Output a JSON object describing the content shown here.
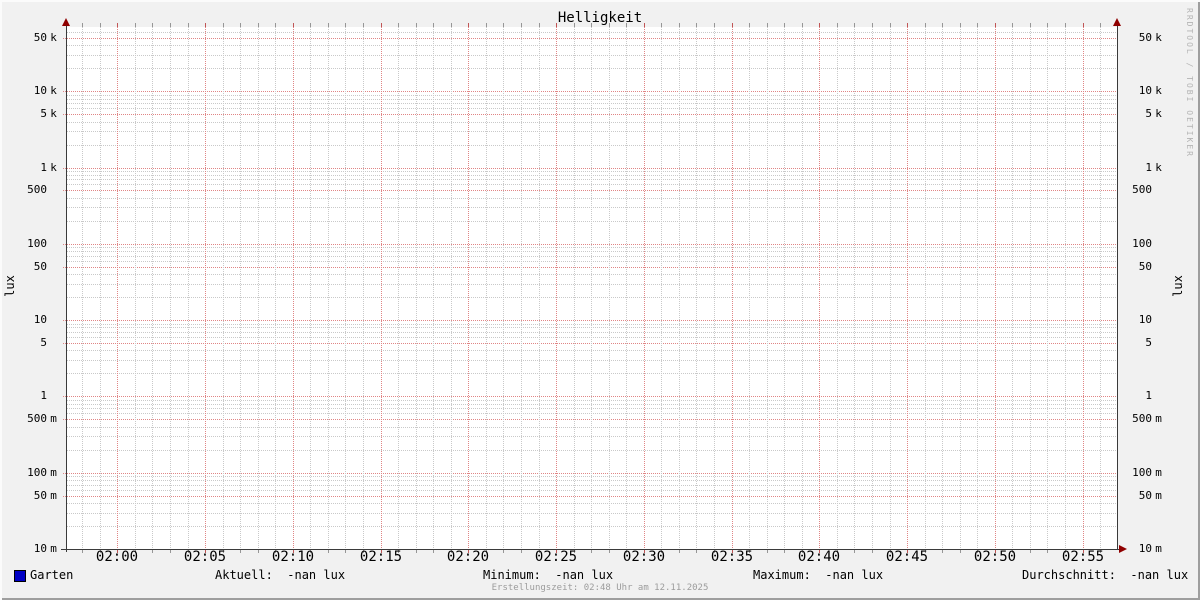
{
  "title": "Helligkeit",
  "watermark": "RRDTOOL / TOBI OETIKER",
  "footer": "Erstellungszeit: 02:48 Uhr am 12.11.2025",
  "y_axis": {
    "unit_left": "lux",
    "unit_right": "lux",
    "ticks": [
      {
        "v": 50000,
        "num": "50",
        "suffix": "k"
      },
      {
        "v": 10000,
        "num": "10",
        "suffix": "k"
      },
      {
        "v": 5000,
        "num": "5",
        "suffix": "k"
      },
      {
        "v": 1000,
        "num": "1",
        "suffix": "k"
      },
      {
        "v": 500,
        "num": "500",
        "suffix": ""
      },
      {
        "v": 100,
        "num": "100",
        "suffix": ""
      },
      {
        "v": 50,
        "num": "50",
        "suffix": ""
      },
      {
        "v": 10,
        "num": "10",
        "suffix": ""
      },
      {
        "v": 5,
        "num": "5",
        "suffix": ""
      },
      {
        "v": 1,
        "num": "1",
        "suffix": ""
      },
      {
        "v": 0.5,
        "num": "500",
        "suffix": "m"
      },
      {
        "v": 0.1,
        "num": "100",
        "suffix": "m"
      },
      {
        "v": 0.05,
        "num": "50",
        "suffix": "m"
      },
      {
        "v": 0.01,
        "num": "10",
        "suffix": "m"
      }
    ]
  },
  "x_axis": {
    "labels": [
      "02:00",
      "02:05",
      "02:10",
      "02:15",
      "02:20",
      "02:25",
      "02:30",
      "02:35",
      "02:40",
      "02:45",
      "02:50",
      "02:55"
    ]
  },
  "legend": {
    "series": {
      "label": "Garten",
      "color": "#0000c4"
    },
    "stats": [
      {
        "label": "Aktuell:",
        "value": "-nan lux"
      },
      {
        "label": "Minimum:",
        "value": "-nan lux"
      },
      {
        "label": "Maximum:",
        "value": "-nan lux"
      },
      {
        "label": "Durchschnitt:",
        "value": "-nan lux"
      }
    ]
  },
  "colors": {
    "background": "#f1f1f1",
    "canvas": "#ffffff",
    "grid_major": "#e08585",
    "grid_minor": "#c9c9c9",
    "axis": "#3a3a3a",
    "arrow": "#8f0000",
    "series": "#0000c4",
    "tick_major": "#c05555",
    "tick_minor": "#969696",
    "watermark_text": "#b4b4b4",
    "footer_text": "#9c9c9c"
  },
  "chart_data": {
    "type": "line",
    "title": "Helligkeit",
    "xlabel": "",
    "ylabel": "lux",
    "y_scale": "log",
    "ylim": [
      0.01,
      70000
    ],
    "y_tick_labels": [
      "50 k",
      "10 k",
      "5 k",
      "1 k",
      "500",
      "100",
      "50",
      "10",
      "5",
      "1",
      "500 m",
      "100 m",
      "50 m",
      "10 m"
    ],
    "x_tick_labels": [
      "02:00",
      "02:05",
      "02:10",
      "02:15",
      "02:20",
      "02:25",
      "02:30",
      "02:35",
      "02:40",
      "02:45",
      "02:50",
      "02:55"
    ],
    "x_range": [
      "01:58",
      "02:57"
    ],
    "grid": "on",
    "legend_position": "bottom",
    "series": [
      {
        "name": "Garten",
        "color": "#0000c4",
        "values": []
      }
    ],
    "stats": {
      "aktuell": "-nan lux",
      "minimum": "-nan lux",
      "maximum": "-nan lux",
      "durchschnitt": "-nan lux"
    }
  }
}
